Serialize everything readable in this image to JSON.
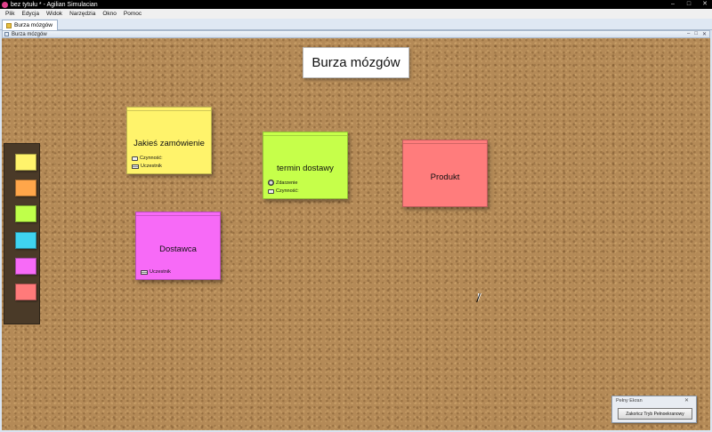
{
  "window": {
    "title": "bez tytułu * - Agilian Simulacian",
    "controls": [
      "–",
      "□",
      "✕"
    ]
  },
  "menu": {
    "items": [
      "Plik",
      "Edycja",
      "Widok",
      "Narzędzia",
      "Okno",
      "Pomoc"
    ]
  },
  "tabs": [
    {
      "label": "Burza mózgów"
    }
  ],
  "frame": {
    "title": "Burza mózgów",
    "controls": [
      "–",
      "□",
      "✕"
    ]
  },
  "board": {
    "title": "Burza mózgów",
    "palette": {
      "colors": [
        "#fff36b",
        "#ffa64a",
        "#bfff4a",
        "#3fd4f0",
        "#f76af7",
        "#ff7a7a"
      ]
    },
    "notes": [
      {
        "title": "Jakieś zamówienie",
        "color": "#fff36b",
        "rows": [
          {
            "icon": "box-icon",
            "label": "Czynność:"
          },
          {
            "icon": "list-icon",
            "label": "Uczestnik"
          }
        ]
      },
      {
        "title": "termin dostawy",
        "color": "#c6ff4a",
        "rows": [
          {
            "icon": "circle-icon",
            "label": "Zdarzenie"
          },
          {
            "icon": "box-icon",
            "label": "Czynność:"
          }
        ]
      },
      {
        "title": "Produkt",
        "color": "#ff7c7c",
        "rows": []
      },
      {
        "title": "Dostawca",
        "color": "#f76af7",
        "rows": [
          {
            "icon": "list-icon",
            "label": "Uczestnik"
          }
        ]
      }
    ]
  },
  "fullscreen": {
    "title": "Pełny Ekran",
    "close": "✕",
    "button_label": "Zakończ Tryb Pełnoekranowy"
  }
}
